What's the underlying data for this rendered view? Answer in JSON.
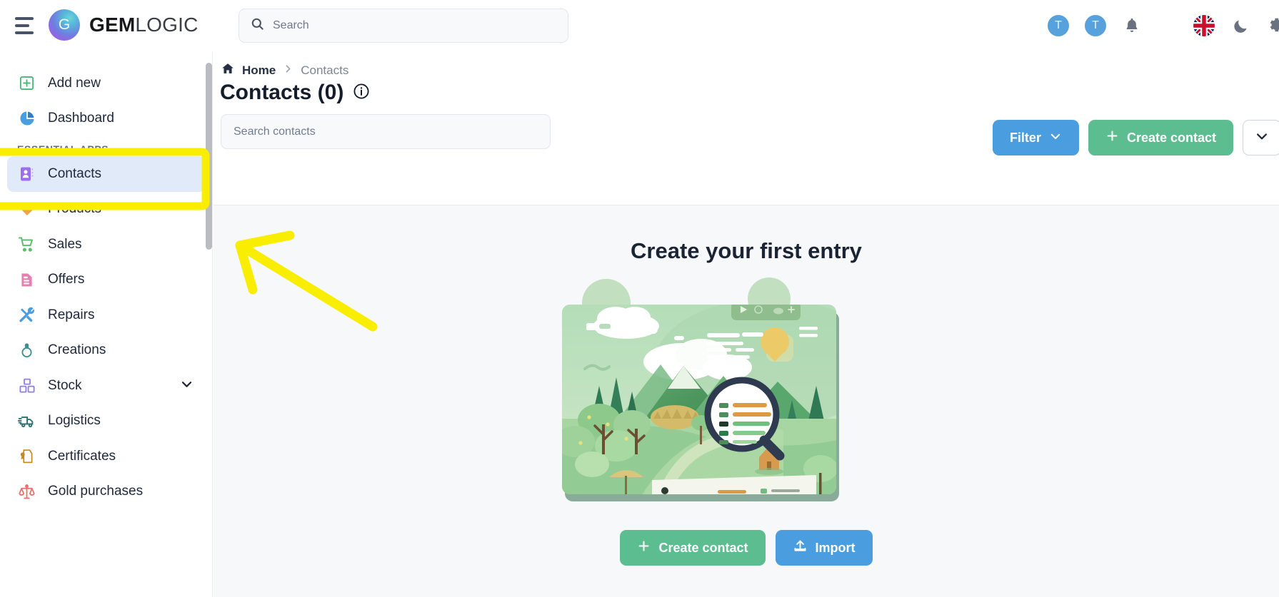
{
  "topbar": {
    "menu_icon": "hamburger-icon",
    "brand": {
      "bold": "GEM",
      "light": "LOGIC",
      "mark_letter": "G"
    },
    "search": {
      "placeholder": "Search",
      "value": "",
      "icon": "search-icon"
    },
    "avatars": [
      {
        "initial": "T"
      },
      {
        "initial": "T"
      }
    ],
    "icons": [
      {
        "name": "bell-icon"
      },
      {
        "name": "apps-grid-icon"
      },
      {
        "name": "language-flag-icon",
        "label": "English (UK)"
      },
      {
        "name": "dark-mode-moon-icon"
      },
      {
        "name": "settings-gear-icon"
      }
    ]
  },
  "sidebar": {
    "top_items": [
      {
        "label": "Add new",
        "icon": "add-new-icon"
      },
      {
        "label": "Dashboard",
        "icon": "dashboard-pie-icon"
      }
    ],
    "section_label": "ESSENTIAL APPS",
    "items": [
      {
        "label": "Contacts",
        "icon": "contacts-book-icon",
        "active": true
      },
      {
        "label": "Products",
        "icon": "product-tag-icon",
        "active": false
      },
      {
        "label": "Sales",
        "icon": "sales-cart-icon",
        "active": false
      },
      {
        "label": "Offers",
        "icon": "offers-document-icon",
        "active": false
      },
      {
        "label": "Repairs",
        "icon": "repairs-tools-icon",
        "active": false
      },
      {
        "label": "Creations",
        "icon": "creations-ring-icon",
        "active": false
      },
      {
        "label": "Stock",
        "icon": "stock-boxes-icon",
        "active": false,
        "expandable": true
      },
      {
        "label": "Logistics",
        "icon": "logistics-truck-icon",
        "active": false
      },
      {
        "label": "Certificates",
        "icon": "certificate-icon",
        "active": false
      },
      {
        "label": "Gold purchases",
        "icon": "scales-icon",
        "active": false
      }
    ]
  },
  "main": {
    "breadcrumb": {
      "home": "Home",
      "separator": "›",
      "current": "Contacts"
    },
    "title": "Contacts (0)",
    "info_icon": "info-circle-icon",
    "search": {
      "placeholder": "Search contacts",
      "value": ""
    },
    "actions": {
      "filter_label": "Filter",
      "create_label": "Create contact",
      "more_caret": "chevron-down-icon"
    },
    "empty_state": {
      "title": "Create your first entry",
      "illustration": "empty-state-landscape-illustration",
      "primary_label": "Create contact",
      "secondary_label": "Import"
    }
  },
  "annotations": {
    "highlight_target": "Contacts",
    "highlight_color": "#f9ed00",
    "arrow_color": "#f9ed00"
  },
  "colors": {
    "accent_blue": "#4a9ee0",
    "accent_green": "#5cbd91",
    "active_nav_bg": "#e0eaf9",
    "body_bg": "#f7f8fa",
    "avatar_blue": "#57a2dd"
  }
}
